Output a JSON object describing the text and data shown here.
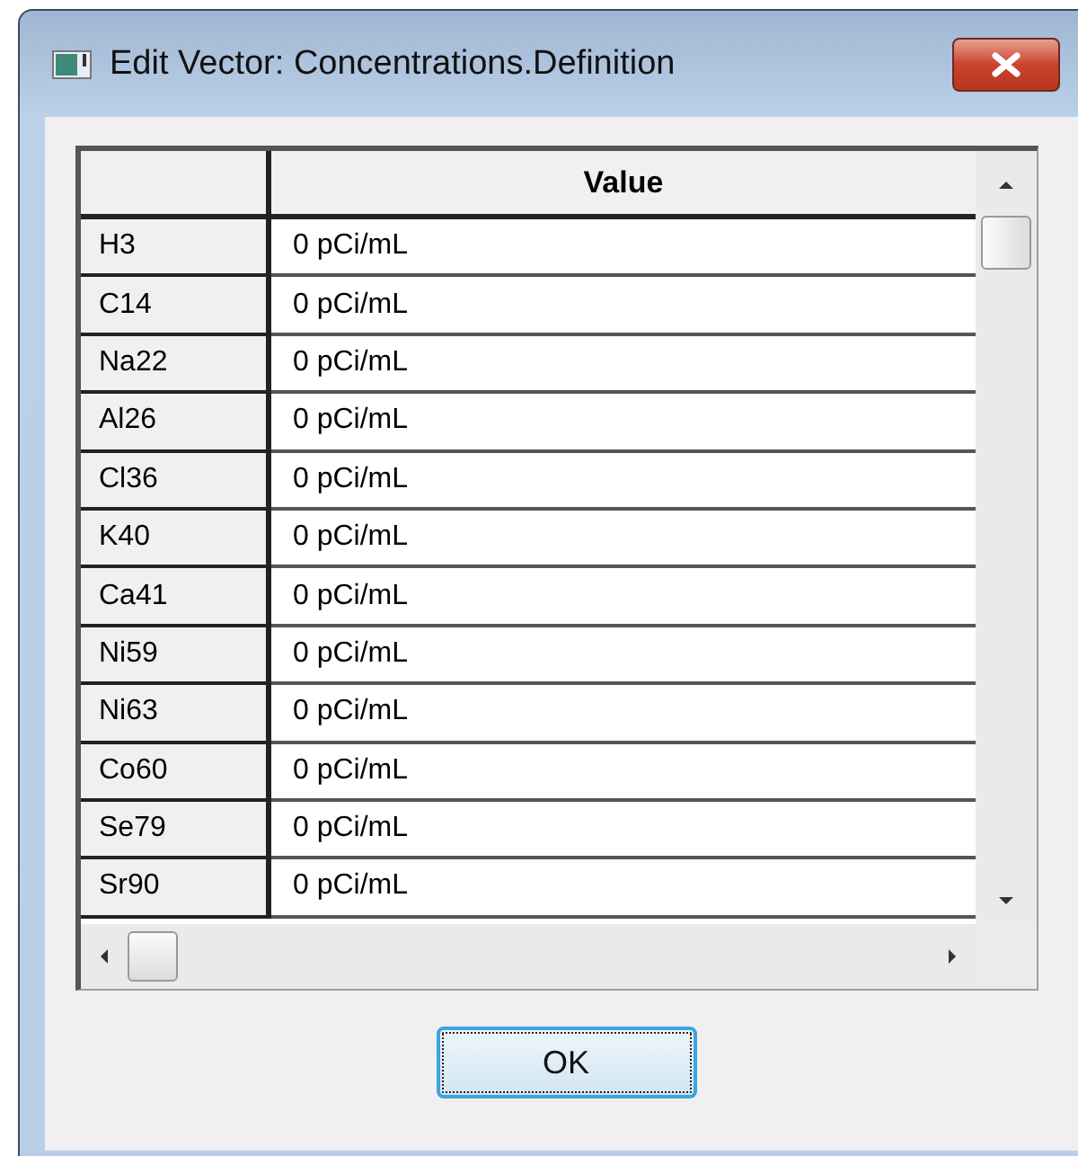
{
  "window": {
    "title": "Edit Vector: Concentrations.Definition"
  },
  "table": {
    "columns": [
      "Value"
    ],
    "rows": [
      {
        "name": "H3",
        "value": "0 pCi/mL"
      },
      {
        "name": "C14",
        "value": "0 pCi/mL"
      },
      {
        "name": "Na22",
        "value": "0 pCi/mL"
      },
      {
        "name": "Al26",
        "value": "0 pCi/mL"
      },
      {
        "name": "Cl36",
        "value": "0 pCi/mL"
      },
      {
        "name": "K40",
        "value": "0 pCi/mL"
      },
      {
        "name": "Ca41",
        "value": "0 pCi/mL"
      },
      {
        "name": "Ni59",
        "value": "0 pCi/mL"
      },
      {
        "name": "Ni63",
        "value": "0 pCi/mL"
      },
      {
        "name": "Co60",
        "value": "0 pCi/mL"
      },
      {
        "name": "Se79",
        "value": "0 pCi/mL"
      },
      {
        "name": "Sr90",
        "value": "0 pCi/mL"
      }
    ]
  },
  "buttons": [
    "OK"
  ]
}
